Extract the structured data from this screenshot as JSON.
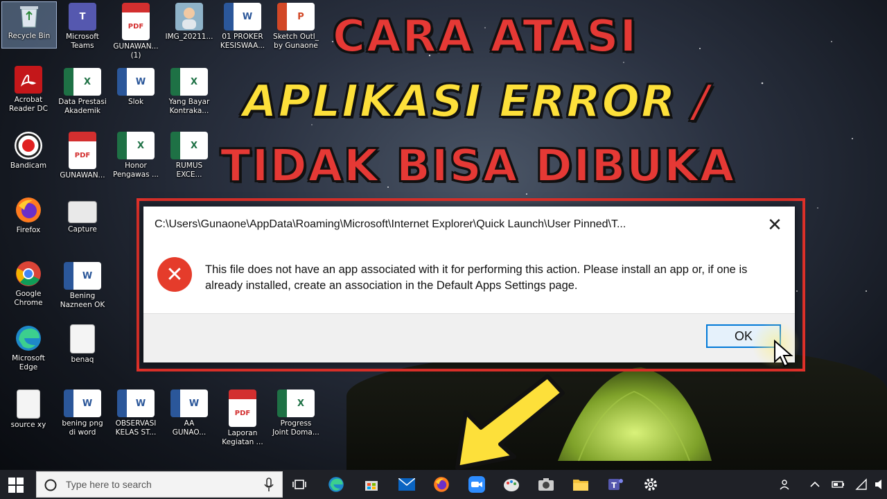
{
  "overlay_title": {
    "line1": "CARA ATASI",
    "line2": "APLIKASI ERROR",
    "line2_slash": "/",
    "line3": "TIDAK BISA DIBUKA"
  },
  "desktop_icons": [
    {
      "label": "Recycle Bin",
      "icon": "recycle-bin-icon"
    },
    {
      "label": "Microsoft\nTeams",
      "icon": "teams-icon"
    },
    {
      "label": "GUNAWAN...\n(1)",
      "icon": "pdf-icon"
    },
    {
      "label": "IMG_20211...",
      "icon": "photo-icon"
    },
    {
      "label": "01 PROKER\nKESISWAA...",
      "icon": "word-icon"
    },
    {
      "label": "Sketch Outl_\nby Gunaone",
      "icon": "powerpoint-icon"
    },
    {
      "label": "Acrobat\nReader DC",
      "icon": "acrobat-icon"
    },
    {
      "label": "Data Prestasi\nAkademik",
      "icon": "excel-icon"
    },
    {
      "label": "Slok",
      "icon": "word-icon"
    },
    {
      "label": "Yang Bayar\nKontraka...",
      "icon": "excel-icon"
    },
    {
      "label": "Bandicam",
      "icon": "bandicam-icon"
    },
    {
      "label": "GUNAWAN...",
      "icon": "pdf-icon"
    },
    {
      "label": "Honor\nPengawas ...",
      "icon": "excel-icon"
    },
    {
      "label": "RUMUS\nEXCE...",
      "icon": "excel-icon"
    },
    {
      "label": "Firefox",
      "icon": "firefox-icon"
    },
    {
      "label": "Capture",
      "icon": "image-icon"
    },
    {
      "label": "Google\nChrome",
      "icon": "chrome-icon"
    },
    {
      "label": "Bening\nNazneen OK",
      "icon": "word-icon"
    },
    {
      "label": "Microsoft\nEdge",
      "icon": "edge-icon"
    },
    {
      "label": "benaq",
      "icon": "image-file-icon"
    },
    {
      "label": "source xy",
      "icon": "file-icon"
    },
    {
      "label": "bening png\ndi word",
      "icon": "word-icon"
    },
    {
      "label": "OBSERVASI\nKELAS ST...",
      "icon": "word-icon"
    },
    {
      "label": "AA\nGUNAO...",
      "icon": "word-icon"
    },
    {
      "label": "Laporan\nKegiatan ...",
      "icon": "pdf-icon"
    },
    {
      "label": "Progress\nJoint Doma...",
      "icon": "excel-icon"
    }
  ],
  "dialog": {
    "title": "C:\\Users\\Gunaone\\AppData\\Roaming\\Microsoft\\Internet Explorer\\Quick Launch\\User Pinned\\T...",
    "close": "✕",
    "error_glyph": "✕",
    "message": "This file does not have an app associated with it for performing this action. Please install an app or, if one is already installed, create an association in the Default Apps Settings page.",
    "ok_label": "OK"
  },
  "taskbar": {
    "search_placeholder": "Type here to search",
    "apps": [
      "task-view-icon",
      "edge-icon",
      "store-icon",
      "mail-icon",
      "firefox-icon",
      "zoom-icon",
      "paint-icon",
      "camera-icon",
      "file-explorer-icon",
      "teams-icon",
      "settings-icon"
    ]
  },
  "colors": {
    "title_red": "#e53935",
    "title_yellow": "#fde03a",
    "frame_red": "#e0312a",
    "error_red": "#e53c2b",
    "ok_border": "#0078d7",
    "taskbar": "#1f2127"
  }
}
